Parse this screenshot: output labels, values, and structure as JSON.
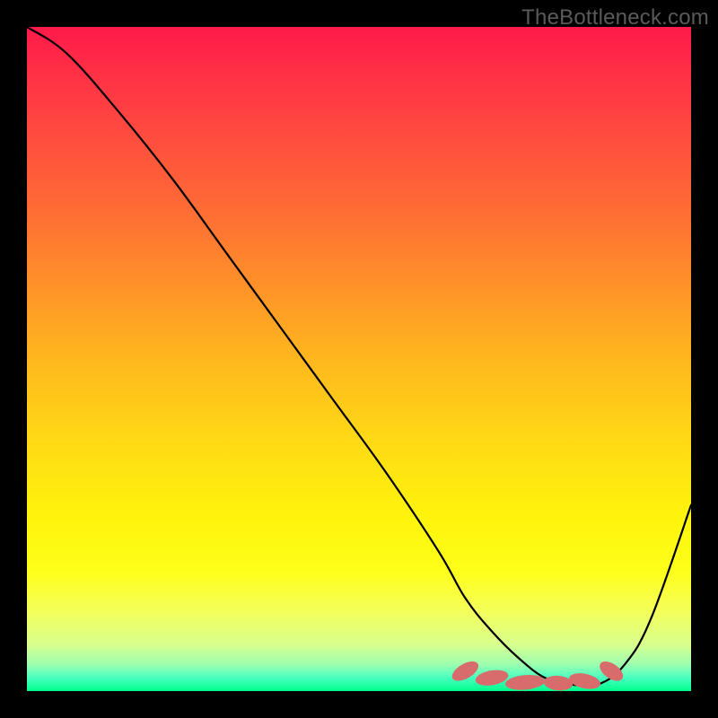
{
  "watermark": "TheBottleneck.com",
  "colors": {
    "page_bg": "#000000",
    "gradient_top": "#ff1a4b",
    "gradient_bottom": "#00ff8a",
    "curve_stroke": "#000000",
    "marker_fill": "#d86b6b"
  },
  "chart_data": {
    "type": "line",
    "title": "",
    "xlabel": "",
    "ylabel": "",
    "xlim": [
      0,
      100
    ],
    "ylim": [
      0,
      100
    ],
    "series": [
      {
        "name": "bottleneck-curve",
        "x": [
          0,
          6,
          14,
          22,
          30,
          38,
          46,
          54,
          62,
          66,
          70,
          74,
          78,
          82,
          86,
          90,
          94,
          100
        ],
        "values": [
          100,
          96,
          87,
          77,
          66,
          55,
          44,
          33,
          21,
          14,
          9,
          5,
          2,
          1,
          1,
          4,
          11,
          28
        ]
      }
    ],
    "markers": [
      {
        "x": 66,
        "y": 3,
        "rx": 2.2,
        "ry": 1.1,
        "rot": -30
      },
      {
        "x": 70,
        "y": 2,
        "rx": 2.5,
        "ry": 1.1,
        "rot": -10
      },
      {
        "x": 75,
        "y": 1.3,
        "rx": 3.0,
        "ry": 1.1,
        "rot": -5
      },
      {
        "x": 80,
        "y": 1.2,
        "rx": 2.2,
        "ry": 1.1,
        "rot": 5
      },
      {
        "x": 84,
        "y": 1.5,
        "rx": 2.4,
        "ry": 1.1,
        "rot": 12
      },
      {
        "x": 88,
        "y": 3,
        "rx": 2.0,
        "ry": 1.1,
        "rot": 35
      }
    ]
  }
}
